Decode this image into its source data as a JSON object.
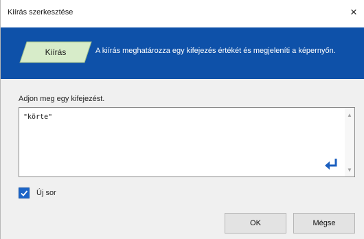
{
  "window": {
    "title": "Kiírás szerkesztése",
    "close_glyph": "×"
  },
  "banner": {
    "shape_label": "Kiírás",
    "description": "A kiírás meghatározza egy kifejezés értékét és megjeleníti a képernyőn.",
    "background_color": "#0e51a9",
    "shape_color": "#d7ecc9"
  },
  "expression": {
    "prompt": "Adjon meg egy kifejezést.",
    "value": "\"körte\""
  },
  "newline_checkbox": {
    "label": "Új sor",
    "checked": true
  },
  "buttons": {
    "ok": "OK",
    "cancel": "Mégse"
  }
}
